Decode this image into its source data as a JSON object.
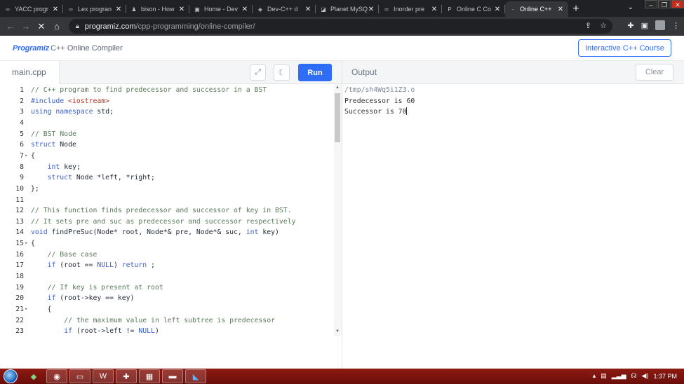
{
  "browser": {
    "tabs": [
      {
        "title": "YACC progr",
        "icon": "∞"
      },
      {
        "title": "Lex progran",
        "icon": "∞"
      },
      {
        "title": "bison - How",
        "icon": "♟"
      },
      {
        "title": "Home - Dev",
        "icon": "▣"
      },
      {
        "title": "Dev-C++ d",
        "icon": "◈"
      },
      {
        "title": "Planet MySQ",
        "icon": "◪"
      },
      {
        "title": "Inorder pre",
        "icon": "∞"
      },
      {
        "title": "Online C Co",
        "icon": "P"
      },
      {
        "title": "Online C++",
        "icon": "·"
      }
    ],
    "url_host": "programiz.com",
    "url_path": "/cpp-programming/online-compiler/"
  },
  "header": {
    "logo_text": "Programiz",
    "subtitle": "C++ Online Compiler",
    "course_button": "Interactive C++ Course"
  },
  "editor": {
    "filename": "main.cpp",
    "run_label": "Run",
    "lines": [
      {
        "n": "1",
        "fold": "",
        "html": "<span class='c-com'>// C++ program to find predecessor and successor in a BST</span>"
      },
      {
        "n": "2",
        "fold": "",
        "html": "<span class='c-kw'>#include</span> <span class='c-str'>&lt;iostream&gt;</span>"
      },
      {
        "n": "3",
        "fold": "",
        "html": "<span class='c-kw'>using</span> <span class='c-kw'>namespace</span> std;"
      },
      {
        "n": "4",
        "fold": "",
        "html": ""
      },
      {
        "n": "5",
        "fold": "",
        "html": "<span class='c-com'>// BST Node</span>"
      },
      {
        "n": "6",
        "fold": "",
        "html": "<span class='c-kw'>struct</span> Node"
      },
      {
        "n": "7",
        "fold": "▾",
        "html": "{"
      },
      {
        "n": "8",
        "fold": "",
        "html": "    <span class='c-kw'>int</span> key;"
      },
      {
        "n": "9",
        "fold": "",
        "html": "    <span class='c-kw'>struct</span> Node *left, *right;"
      },
      {
        "n": "10",
        "fold": "",
        "html": "};"
      },
      {
        "n": "11",
        "fold": "",
        "html": ""
      },
      {
        "n": "12",
        "fold": "",
        "html": "<span class='c-com'>// This function finds predecessor and successor of key in BST.</span>"
      },
      {
        "n": "13",
        "fold": "",
        "html": "<span class='c-com'>// It sets pre and suc as predecessor and successor respectively</span>"
      },
      {
        "n": "14",
        "fold": "",
        "html": "<span class='c-kw'>void</span> findPreSuc(Node* root, Node*&amp; pre, Node*&amp; suc, <span class='c-kw'>int</span> key)"
      },
      {
        "n": "15",
        "fold": "▾",
        "html": "{"
      },
      {
        "n": "16",
        "fold": "",
        "html": "    <span class='c-com'>// Base case</span>"
      },
      {
        "n": "17",
        "fold": "",
        "html": "    <span class='c-kw'>if</span> (root == <span class='c-kw'>NULL</span>) <span class='c-kw'>return</span> ;"
      },
      {
        "n": "18",
        "fold": "",
        "html": ""
      },
      {
        "n": "19",
        "fold": "",
        "html": "    <span class='c-com'>// If key is present at root</span>"
      },
      {
        "n": "20",
        "fold": "",
        "html": "    <span class='c-kw'>if</span> (root-&gt;key == key)"
      },
      {
        "n": "21",
        "fold": "▾",
        "html": "    {"
      },
      {
        "n": "22",
        "fold": "",
        "html": "        <span class='c-com'>// the maximum value in left subtree is predecessor</span>"
      },
      {
        "n": "23",
        "fold": "",
        "html": "        <span class='c-kw'>if</span> (root-&gt;left != <span class='c-kw'>NULL</span>)"
      }
    ]
  },
  "output": {
    "label": "Output",
    "clear_label": "Clear",
    "lines": [
      "/tmp/sh4Wq5i1Z3.o",
      "Predecessor is 60",
      "Successor is 70"
    ]
  },
  "taskbar": {
    "time": "1:37 PM"
  }
}
